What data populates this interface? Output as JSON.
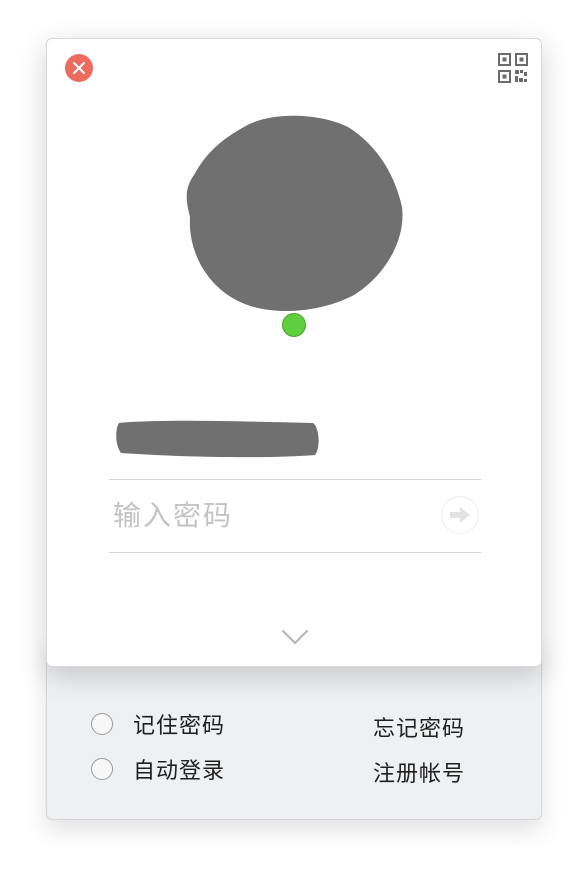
{
  "login": {
    "password_placeholder": "输入密码"
  },
  "options": {
    "remember_password": "记住密码",
    "auto_login": "自动登录",
    "forgot_password": "忘记密码",
    "register_account": "注册帐号"
  },
  "icons": {
    "close": "close-icon",
    "qr": "qr-code-icon",
    "submit": "arrow-right-icon",
    "expand": "chevron-down-icon"
  },
  "colors": {
    "close_button": "#ec6a5e",
    "online_status": "#5fce3f",
    "avatar_redaction": "#707070"
  }
}
